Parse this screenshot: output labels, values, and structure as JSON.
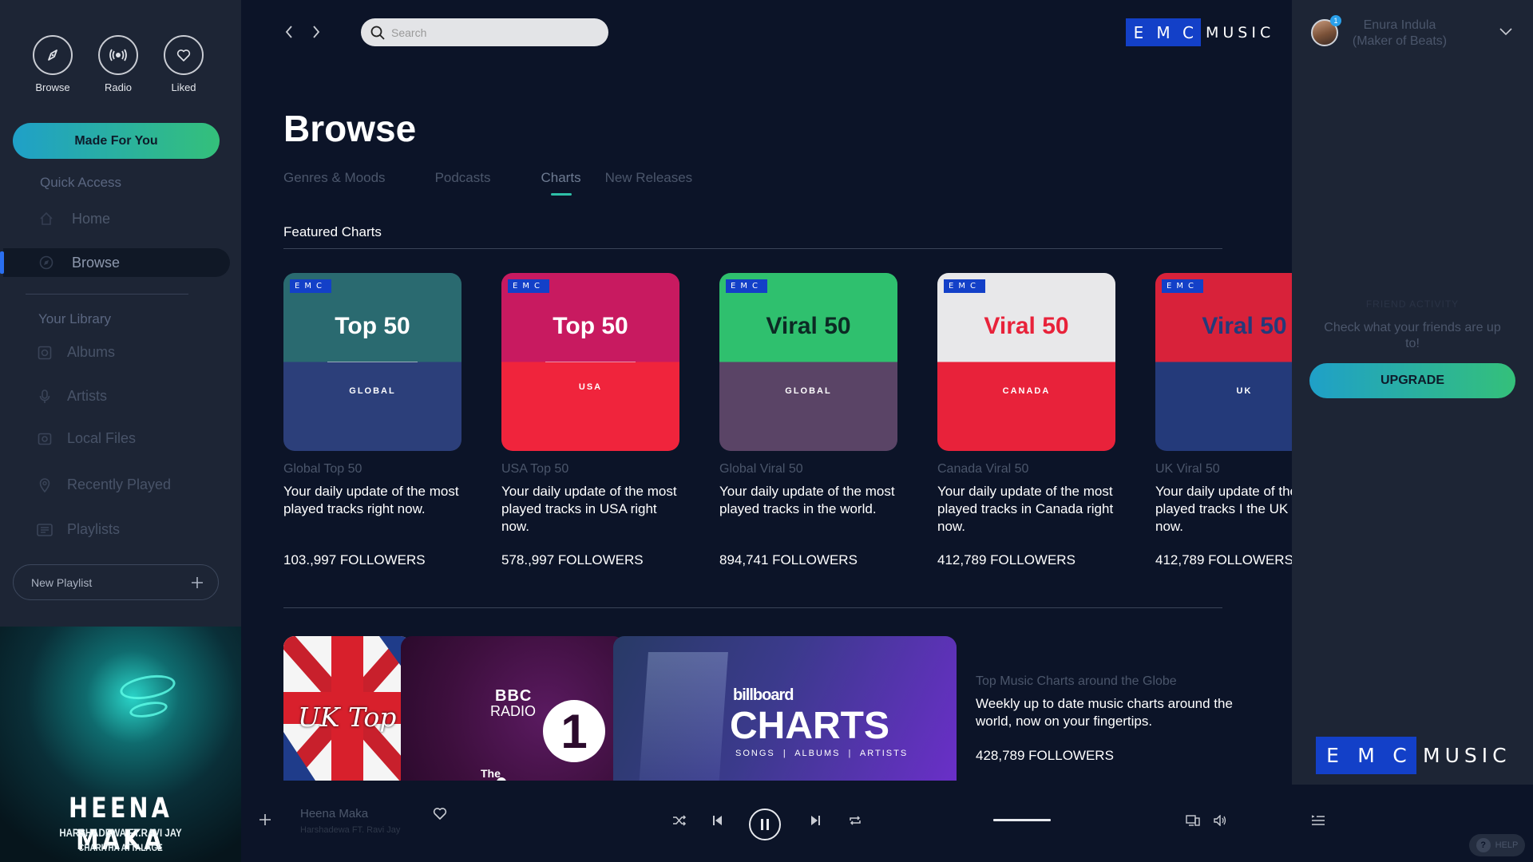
{
  "sidebar": {
    "top_icons": [
      {
        "label": "Browse",
        "icon": "compass-icon"
      },
      {
        "label": "Radio",
        "icon": "radio-broadcast-icon"
      },
      {
        "label": "Liked",
        "icon": "heart-icon"
      }
    ],
    "made_for_you": "Made For You",
    "quick_access_title": "Quick Access",
    "quick_access": [
      {
        "label": "Home",
        "icon": "home-icon"
      },
      {
        "label": "Browse",
        "icon": "compass-icon",
        "active": true
      }
    ],
    "library_title": "Your Library",
    "library": [
      {
        "label": "Albums",
        "icon": "album-icon"
      },
      {
        "label": "Artists",
        "icon": "microphone-icon"
      },
      {
        "label": "Local Files",
        "icon": "file-icon"
      },
      {
        "label": "Recently Played",
        "icon": "location-pin-icon"
      },
      {
        "label": "Playlists",
        "icon": "playlist-icon"
      }
    ],
    "new_playlist": "New Playlist"
  },
  "album_art": {
    "title": "HEENA MAKA",
    "line1": "HARSHADEWA FT.RAVI JAY",
    "line2": "CHARITHA ATTALAGE"
  },
  "header": {
    "search_placeholder": "Search",
    "brand_letters": [
      "E",
      "M",
      "C"
    ],
    "brand_word": "MUSIC"
  },
  "main": {
    "page_title": "Browse",
    "tabs": [
      {
        "label": "Genres & Moods"
      },
      {
        "label": "Podcasts"
      },
      {
        "label": "Charts",
        "active": true
      },
      {
        "label": "New Releases"
      }
    ],
    "featured_title": "Featured Charts",
    "cards": [
      {
        "badge": "EMC",
        "big": "Top 50",
        "small": "GLOBAL",
        "name": "Global Top 50",
        "desc": "Your daily update of the most played tracks right now.",
        "followers": "103.,997 FOLLOWERS",
        "bg_top": "#2a6a70",
        "bg_bottom": "#2c3f7a"
      },
      {
        "badge": "EMC",
        "big": "Top 50",
        "small": "USA",
        "name": "USA Top 50",
        "desc": "Your daily update of the most played tracks in USA right now.",
        "followers": "578.,997 FOLLOWERS",
        "bg_top": "#c81a60",
        "bg_bottom": "#f0243c"
      },
      {
        "badge": "EMC",
        "big": "Viral 50",
        "small": "GLOBAL",
        "name": "Global Viral 50",
        "desc": "Your daily update of the most played tracks in the world.",
        "followers": "894,741 FOLLOWERS",
        "bg_top": "#2fc06e",
        "bg_bottom": "#5a4466"
      },
      {
        "badge": "EMC",
        "big": "Viral 50",
        "small": "CANADA",
        "name": "Canada Viral 50",
        "desc": "Your daily update of the most played tracks in Canada right now.",
        "followers": "412,789 FOLLOWERS",
        "bg_top": "#e8e8ea",
        "bg_bottom": "#e8223a"
      },
      {
        "badge": "EMC",
        "big": "Viral 50",
        "small": "UK",
        "name": "UK Viral 50",
        "desc": "Your daily update of the most played tracks I the UK right now.",
        "followers": "412,789 FOLLOWERS",
        "bg_top": "#d8223a",
        "bg_bottom": "#243a7a"
      }
    ],
    "banner": {
      "uk_text": "UK Top",
      "bbc_line1": "BBC",
      "bbc_line2": "RADIO",
      "bbc_num": "1",
      "bbc_caption": "The",
      "billboard_small": "billboard",
      "billboard_big": "CHARTS",
      "billboard_sub": "SONGS  |  ALBUMS  |  ARTISTS",
      "name": "Top Music Charts around the Globe",
      "desc": "Weekly up to date music charts around the world, now on your fingertips.",
      "followers": "428,789 FOLLOWERS"
    },
    "progress_fraction": 0.248
  },
  "player": {
    "track_title": "Heena Maka",
    "track_artist": "Harshadewa FT. Ravi Jay",
    "volume_fraction": 1.0
  },
  "right_panel": {
    "user_name_line1": "Enura Indula",
    "user_name_line2": "(Maker of Beats)",
    "notification_count": "1",
    "friend_activity_title": "FRIEND ACTIVITY",
    "friend_activity_text": "Check what your friends are up to!",
    "upgrade": "UPGRADE",
    "help": "HELP"
  },
  "colors": {
    "accent_gradient_start": "#1fa0c8",
    "accent_gradient_end": "#34c07a",
    "brand_blue": "#1340c8",
    "background": "#0c1428",
    "sidebar": "#1d2535"
  }
}
